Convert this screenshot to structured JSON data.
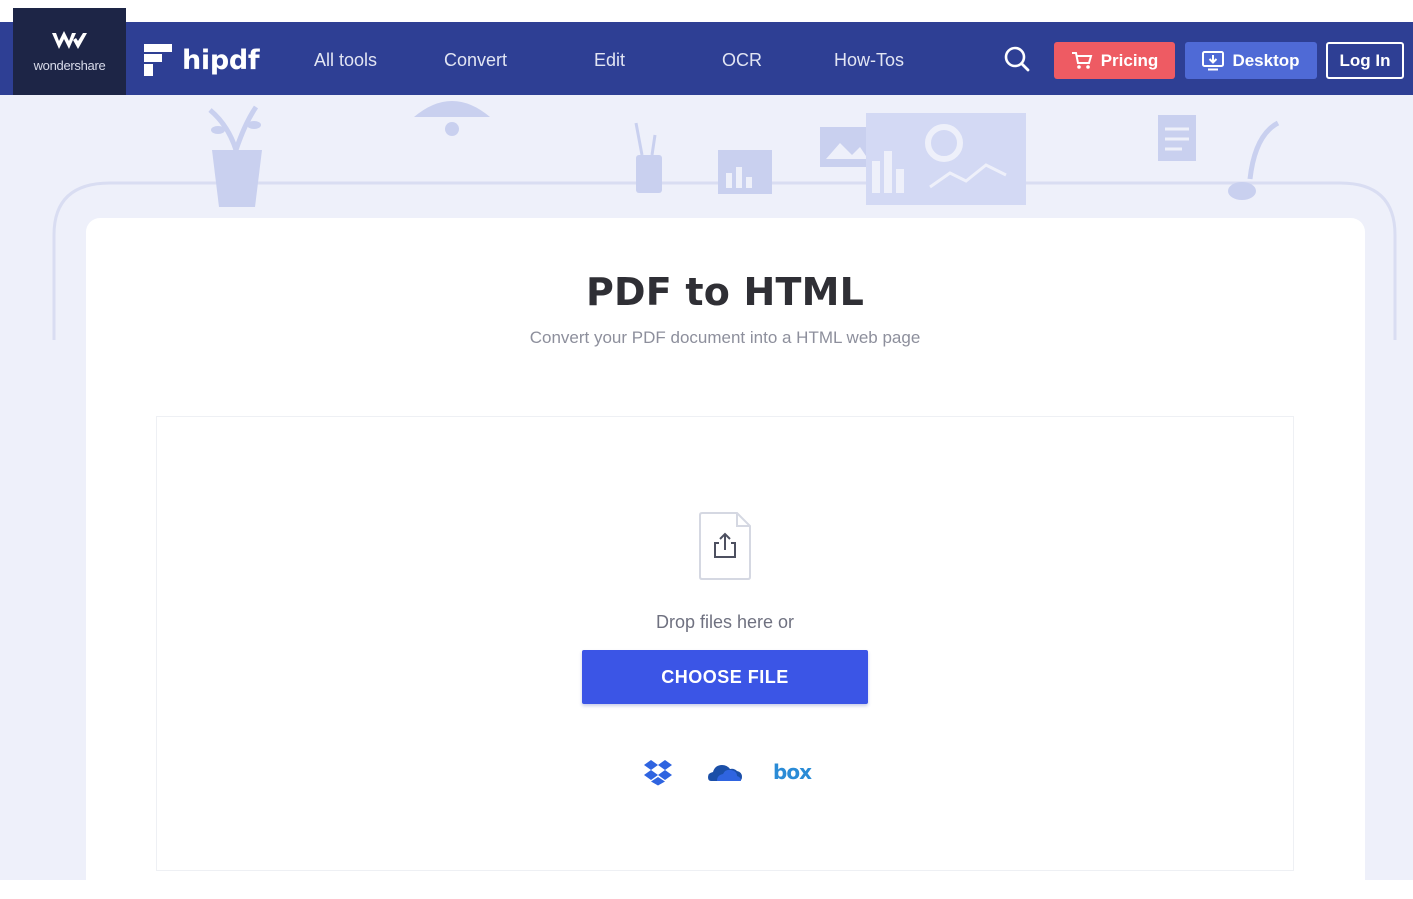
{
  "header": {
    "wondershare_label": "wondershare",
    "brand_name": "hipdf",
    "nav": [
      {
        "label": "All tools"
      },
      {
        "label": "Convert"
      },
      {
        "label": "Edit"
      },
      {
        "label": "OCR"
      },
      {
        "label": "How-Tos"
      }
    ],
    "search_icon": "search-icon",
    "pricing_label": "Pricing",
    "desktop_label": "Desktop",
    "login_label": "Log In"
  },
  "main": {
    "title": "PDF to HTML",
    "subtitle": "Convert your PDF document into a HTML web page",
    "drop_text": "Drop files here or",
    "choose_file_label": "CHOOSE FILE",
    "cloud_sources": [
      {
        "icon": "dropbox-icon"
      },
      {
        "icon": "onedrive-icon"
      },
      {
        "icon": "box-icon",
        "label": "box"
      }
    ]
  },
  "colors": {
    "header_bg": "#2e3f94",
    "wondershare_bg": "#1d2546",
    "pricing": "#ee5b63",
    "desktop": "#4f6ad6",
    "primary_button": "#3b55e6",
    "hero_bg": "#eef0fa"
  }
}
